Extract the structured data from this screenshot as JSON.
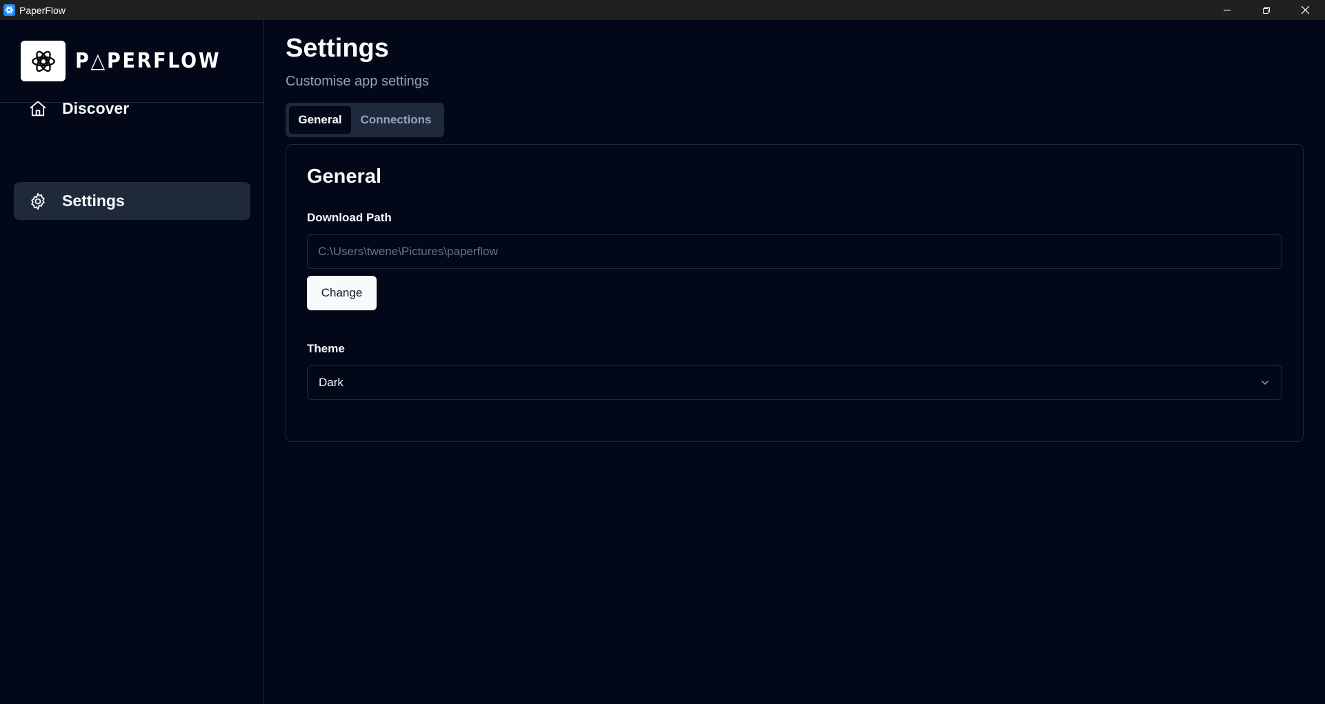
{
  "window": {
    "title": "PaperFlow",
    "icon": "paperflow-app-icon",
    "controls": [
      "minimize-icon",
      "restore-icon",
      "close-icon"
    ]
  },
  "sidebar": {
    "brand_name": "P△PERFLOW",
    "brand_logo": "knot-logo",
    "items": [
      {
        "label": "Discover",
        "icon": "home-icon",
        "active": false
      },
      {
        "label": "Settings",
        "icon": "gear-icon",
        "active": true
      }
    ]
  },
  "main": {
    "title": "Settings",
    "subtitle": "Customise app settings",
    "tabs": [
      {
        "label": "General",
        "active": true
      },
      {
        "label": "Connections",
        "active": false
      }
    ],
    "card": {
      "title": "General",
      "download_path": {
        "label": "Download Path",
        "placeholder": "C:\\Users\\twene\\Pictures\\paperflow",
        "button_label": "Change"
      },
      "theme": {
        "label": "Theme",
        "selected": "Dark",
        "icon": "chevron-down-icon"
      }
    }
  },
  "colors": {
    "background": "#020817",
    "titlebar": "#202020",
    "border": "#1e293b",
    "muted_text": "#94a3b8",
    "primary_button": "#f8fafc"
  }
}
